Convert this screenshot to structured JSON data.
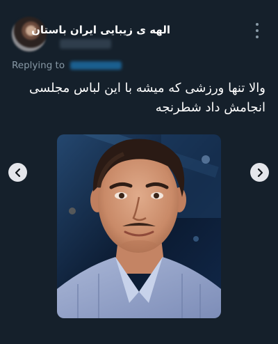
{
  "tweet": {
    "display_name": "الهه ی زیبایی ایران باستان",
    "replying_to_label": "Replying to",
    "text_lines": [
      "والا تنها ورزشی که میشه با این لباس مجلسی",
      "انجامش داد شطرنجه"
    ]
  },
  "colors": {
    "background": "#15202b",
    "muted_text": "#8899a6",
    "link": "#1d9bf0",
    "nav_button": "#e4e6eb"
  },
  "icons": {
    "menu": "more-vertical-icon",
    "prev": "chevron-left-icon",
    "next": "chevron-right-icon"
  }
}
